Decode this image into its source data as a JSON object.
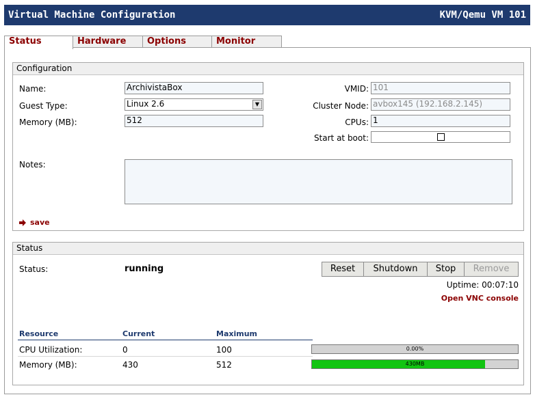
{
  "window": {
    "title": "Virtual Machine Configuration",
    "vm_label": "KVM/Qemu VM 101"
  },
  "tabs": [
    {
      "label": "Status",
      "active": true
    },
    {
      "label": "Hardware",
      "active": false
    },
    {
      "label": "Options",
      "active": false
    },
    {
      "label": "Monitor",
      "active": false
    }
  ],
  "configuration": {
    "header": "Configuration",
    "name_label": "Name:",
    "name_value": "ArchivistaBox",
    "guest_type_label": "Guest Type:",
    "guest_type_value": "Linux 2.6",
    "memory_label": "Memory (MB):",
    "memory_value": "512",
    "vmid_label": "VMID:",
    "vmid_value": "101",
    "cluster_node_label": "Cluster Node:",
    "cluster_node_value": "avbox145 (192.168.2.145)",
    "cpus_label": "CPUs:",
    "cpus_value": "1",
    "start_at_boot_label": "Start at boot:",
    "start_at_boot_checked": false,
    "notes_label": "Notes:",
    "notes_value": "",
    "save_label": "save"
  },
  "status": {
    "header": "Status",
    "status_label": "Status:",
    "status_value": "running",
    "buttons": {
      "reset": "Reset",
      "shutdown": "Shutdown",
      "stop": "Stop",
      "remove": "Remove"
    },
    "uptime": "Uptime: 00:07:10",
    "vnc_link": "Open VNC console",
    "table": {
      "headers": {
        "resource": "Resource",
        "current": "Current",
        "maximum": "Maximum"
      },
      "rows": [
        {
          "resource": "CPU Utilization:",
          "current": "0",
          "maximum": "100",
          "bar_text": "0.00%",
          "fraction": 0.0
        },
        {
          "resource": "Memory (MB):",
          "current": "430",
          "maximum": "512",
          "bar_text": "430MB",
          "fraction": 0.84
        }
      ]
    }
  },
  "colors": {
    "titlebar": "#1e3a6e",
    "tab_text": "#8b0000",
    "bar_fill": "#11c411"
  }
}
